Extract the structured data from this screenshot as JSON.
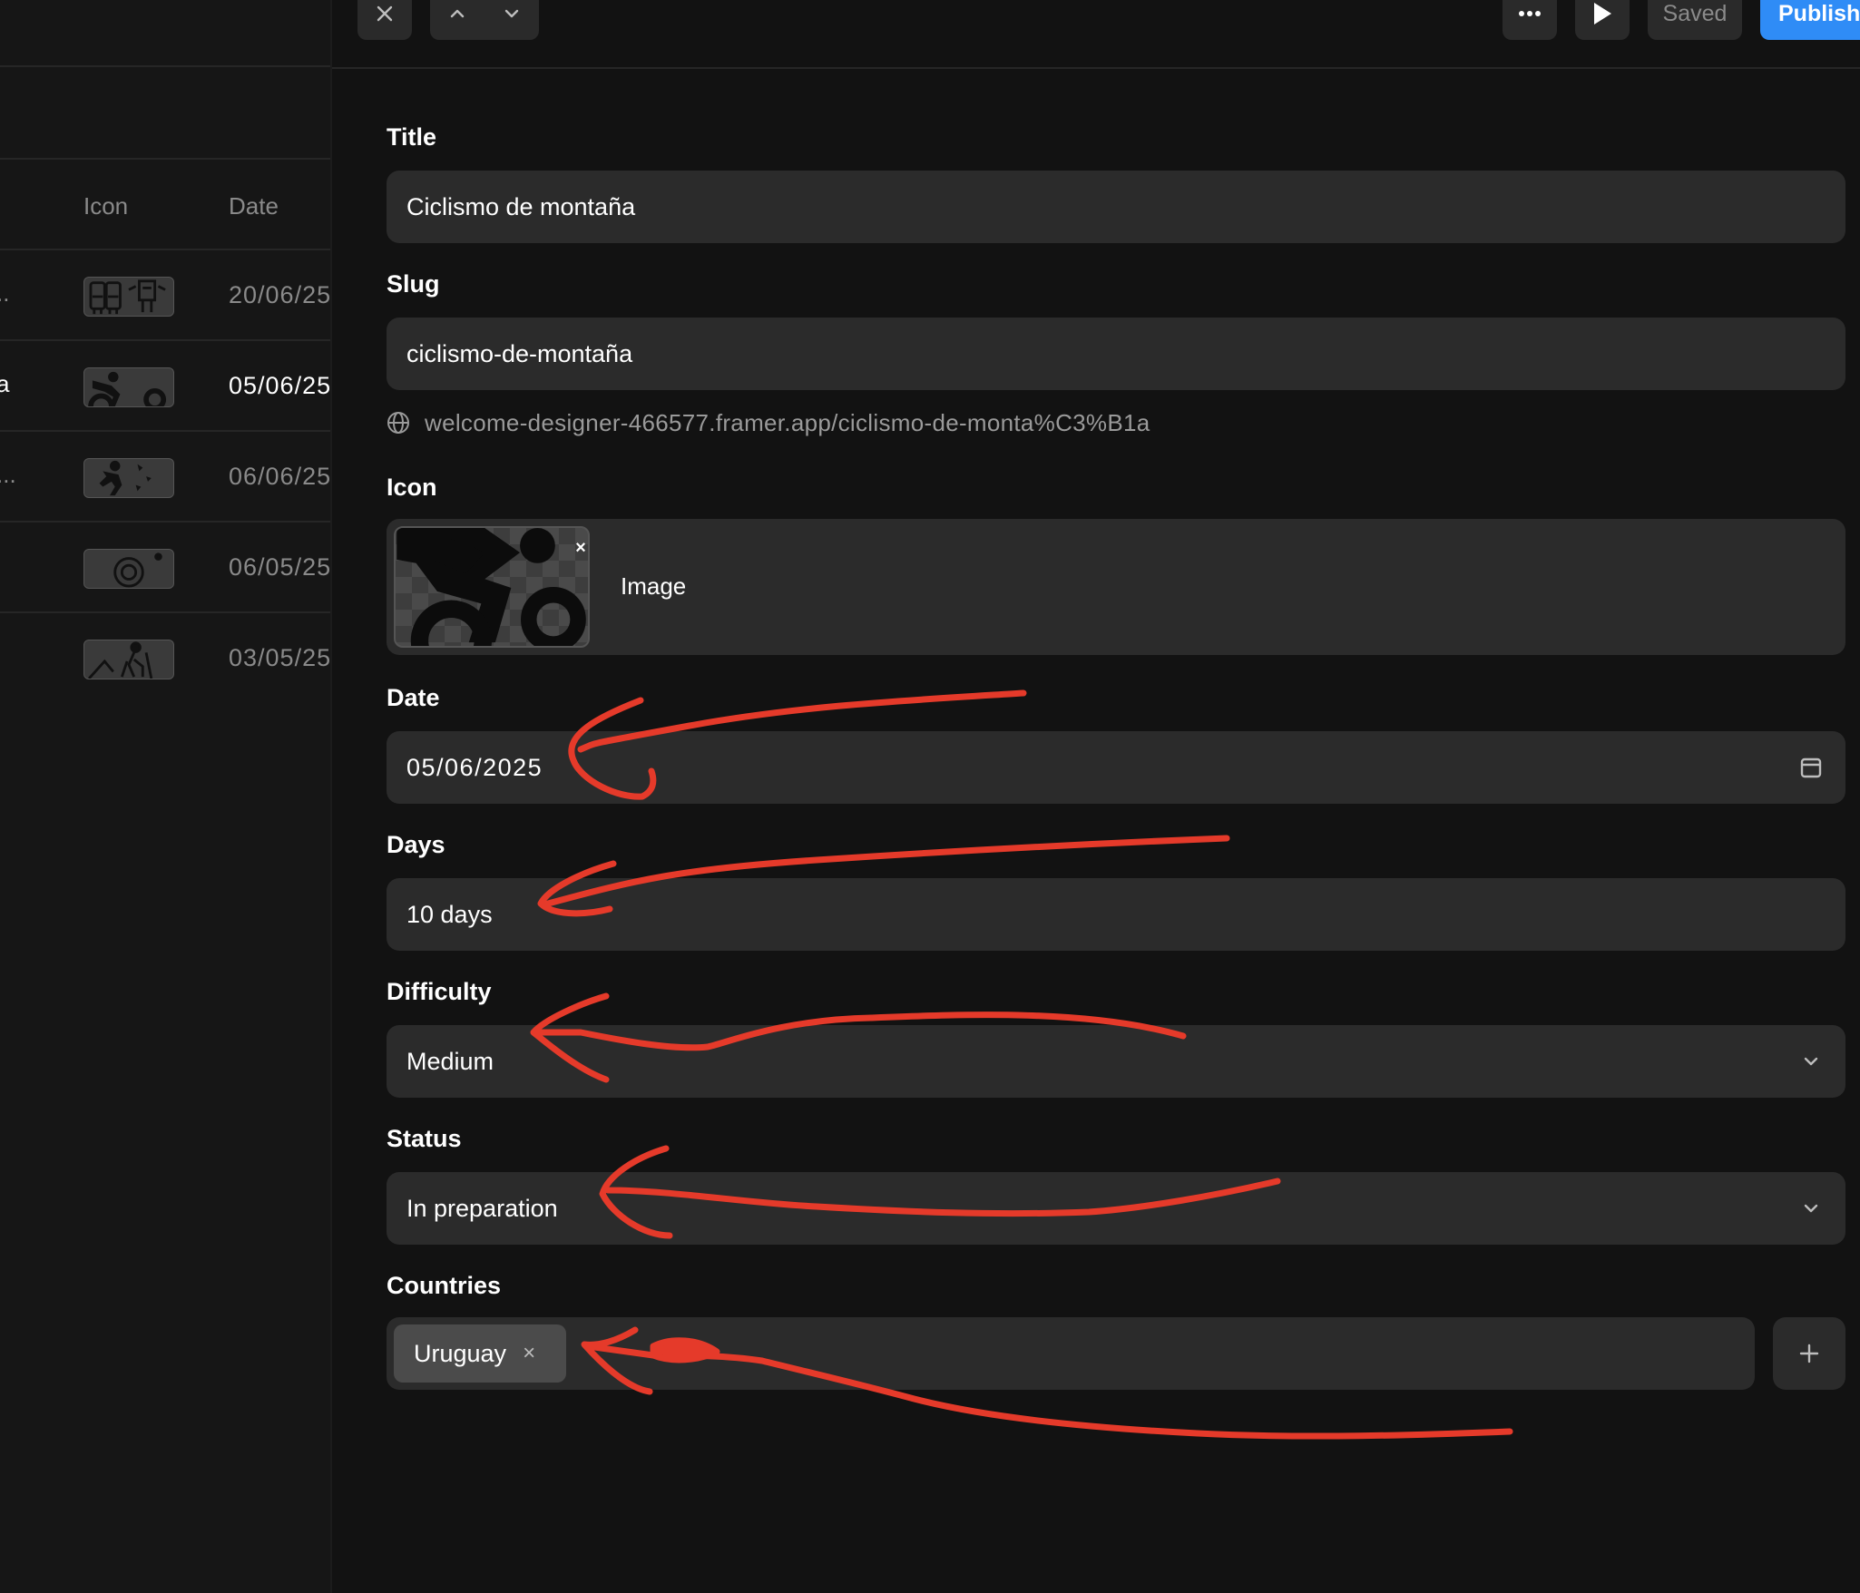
{
  "list": {
    "columns": {
      "icon": "Icon",
      "date": "Date"
    },
    "rows": [
      {
        "name_fragment": "..",
        "icon": "backpack-hiking-icon",
        "date": "20/06/25",
        "active": false
      },
      {
        "name_fragment": "a",
        "icon": "mountain-biking-icon",
        "date": "05/06/25",
        "active": true
      },
      {
        "name_fragment": "...",
        "icon": "climbing-icon",
        "date": "06/06/25",
        "active": false
      },
      {
        "name_fragment": "",
        "icon": "camera-icon",
        "date": "06/05/25",
        "active": false
      },
      {
        "name_fragment": "",
        "icon": "trekking-icon",
        "date": "03/05/25",
        "active": false
      }
    ]
  },
  "toolbar": {
    "close_icon": "close-icon",
    "prev_icon": "chevron-up-icon",
    "next_icon": "chevron-down-icon",
    "more_icon": "more-icon",
    "preview_icon": "play-icon",
    "saved_label": "Saved",
    "publish_label": "Publish",
    "publish_color": "#2f8cf6"
  },
  "form": {
    "title": {
      "label": "Title",
      "value": "Ciclismo de montaña"
    },
    "slug": {
      "label": "Slug",
      "value": "ciclismo-de-montaña",
      "url": "welcome-designer-466577.framer.app/ciclismo-de-monta%C3%B1a"
    },
    "icon": {
      "label": "Icon",
      "caption": "Image",
      "remove_glyph": "×"
    },
    "date": {
      "label": "Date",
      "value": "05/06/2025"
    },
    "days": {
      "label": "Days",
      "value": "10 days"
    },
    "difficulty": {
      "label": "Difficulty",
      "value": "Medium"
    },
    "status": {
      "label": "Status",
      "value": "In preparation"
    },
    "countries": {
      "label": "Countries",
      "chips": [
        "Uruguay"
      ],
      "chip_remove_glyph": "×",
      "add_glyph": "+"
    }
  },
  "annotation_color": "#e53a2a"
}
